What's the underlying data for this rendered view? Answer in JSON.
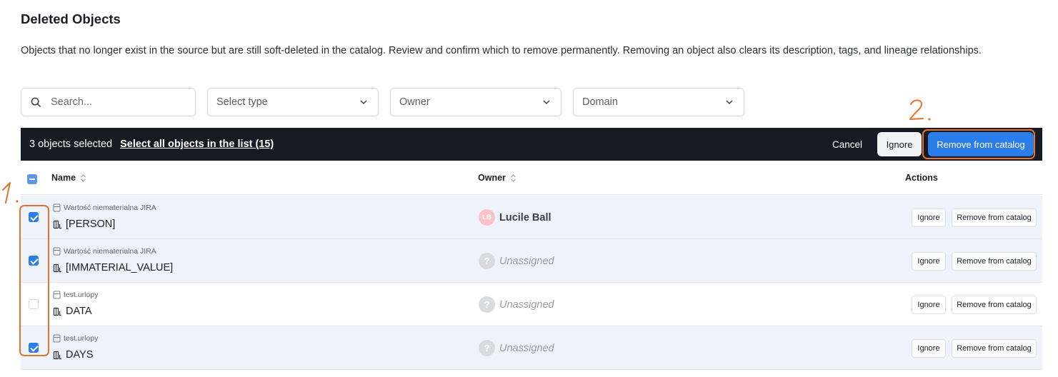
{
  "page": {
    "title": "Deleted Objects",
    "description": "Objects that no longer exist in the source but are still soft-deleted in the catalog. Review and confirm which to remove permanently. Removing an object also clears its description, tags, and lineage relationships."
  },
  "filters": {
    "search_placeholder": "Search...",
    "type_label": "Select type",
    "owner_label": "Owner",
    "domain_label": "Domain"
  },
  "selection_bar": {
    "selected_text": "3 objects selected",
    "select_all_label": "Select all objects in the list (15)",
    "cancel_label": "Cancel",
    "ignore_label": "Ignore",
    "remove_label": "Remove from catalog"
  },
  "table": {
    "columns": {
      "name": "Name",
      "owner": "Owner",
      "actions": "Actions"
    },
    "rows": [
      {
        "parent": "Wartość niematerialna JIRA",
        "name": "[PERSON]",
        "owner": "Lucile Ball",
        "owner_initials": "LB",
        "selected": true,
        "assigned": true
      },
      {
        "parent": "Wartość niematerialna JIRA",
        "name": "[IMMATERIAL_VALUE]",
        "owner": "Unassigned",
        "owner_initials": "?",
        "selected": true,
        "assigned": false
      },
      {
        "parent": "test.urlopy",
        "name": "DATA",
        "owner": "Unassigned",
        "owner_initials": "?",
        "selected": false,
        "assigned": false
      },
      {
        "parent": "test.urlopy",
        "name": "DAYS",
        "owner": "Unassigned",
        "owner_initials": "?",
        "selected": true,
        "assigned": false
      }
    ],
    "row_ignore_label": "Ignore",
    "row_remove_label": "Remove from catalog"
  },
  "annotations": {
    "step1": "1.",
    "step2": "2.",
    "color": "#e8712a"
  },
  "colors": {
    "accent": "#2b7de9",
    "bar_bg": "#161a22",
    "selected_row": "#eef3fb"
  }
}
